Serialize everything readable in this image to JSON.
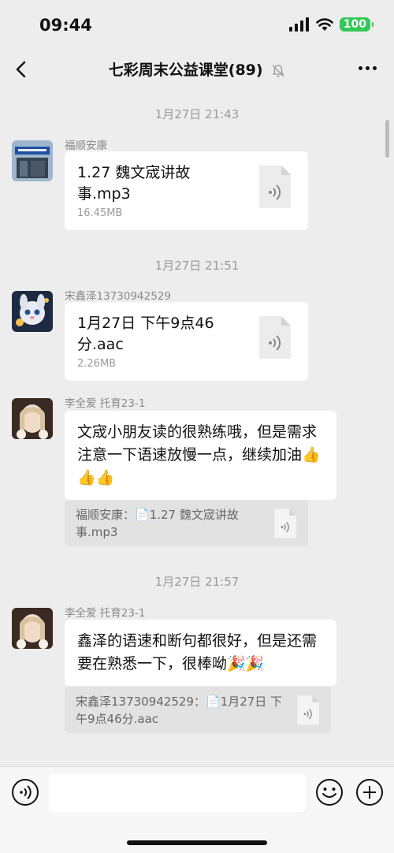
{
  "status": {
    "time": "09:44",
    "battery": "100"
  },
  "header": {
    "title": "七彩周末公益课堂(89)"
  },
  "messages": [
    {
      "timestamp": "1月27日 21:43",
      "sender": "福顺安康",
      "file_name": "1.27 魏文宬讲故事.mp3",
      "file_size": "16.45MB"
    },
    {
      "timestamp": "1月27日 21:51",
      "sender": "宋鑫泽13730942529",
      "file_name": "1月27日 下午9点46分.aac",
      "file_size": "2.26MB"
    },
    {
      "sender": "李全爱 托育23-1",
      "text": "文宬小朋友读的很熟练哦，但是需求注意一下语速放慢一点，继续加油👍👍👍",
      "quote": "福顺安康：📄1.27 魏文宬讲故事.mp3"
    },
    {
      "timestamp": "1月27日 21:57",
      "sender": "李全爱 托育23-1",
      "text": "鑫泽的语速和断句都很好，但是还需要在熟悉一下，很棒呦🎉🎉",
      "quote": "宋鑫泽13730942529：📄1月27日 下午9点46分.aac"
    }
  ],
  "input": {
    "value": ""
  }
}
